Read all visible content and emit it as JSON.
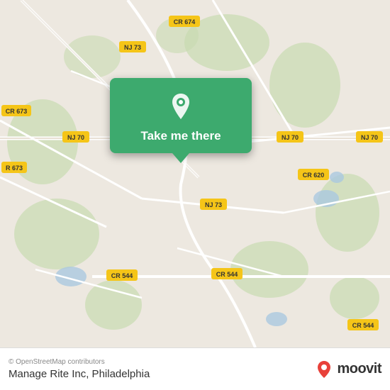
{
  "map": {
    "attribution": "© OpenStreetMap contributors",
    "center_lat": 39.92,
    "center_lng": -74.88
  },
  "popup": {
    "button_label": "Take me there",
    "pin_icon": "location-pin"
  },
  "footer": {
    "copyright": "© OpenStreetMap contributors",
    "location_name": "Manage Rite Inc, Philadelphia",
    "logo_text": "moovit"
  },
  "roads": [
    {
      "label": "CR 674",
      "color": "#f5c842"
    },
    {
      "label": "NJ 73",
      "color": "#f5c842"
    },
    {
      "label": "CR 673",
      "color": "#f5c842"
    },
    {
      "label": "NJ 70",
      "color": "#f5c842"
    },
    {
      "label": "R 673",
      "color": "#f5c842"
    },
    {
      "label": "CR 620",
      "color": "#f5c842"
    },
    {
      "label": "NJ 73",
      "color": "#f5c842"
    },
    {
      "label": "CR 544",
      "color": "#f5c842"
    },
    {
      "label": "CR 544",
      "color": "#f5c842"
    },
    {
      "label": "CR 544",
      "color": "#f5c842"
    }
  ]
}
